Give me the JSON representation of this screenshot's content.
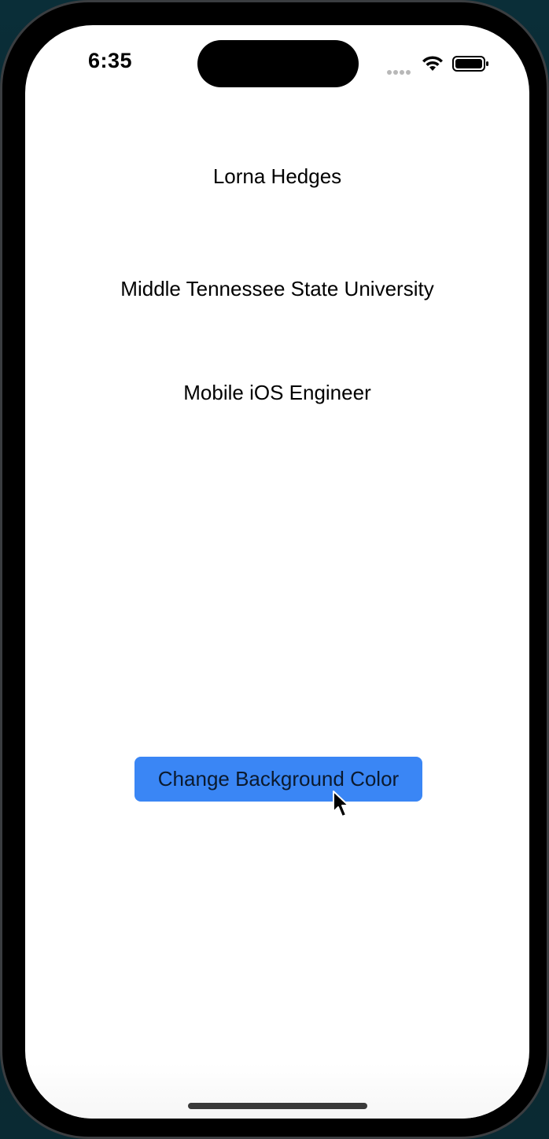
{
  "status_bar": {
    "time": "6:35",
    "icons": [
      "signal-dots-icon",
      "wifi-icon",
      "battery-icon"
    ]
  },
  "content": {
    "name": "Lorna Hedges",
    "university": "Middle Tennessee State University",
    "role": "Mobile iOS Engineer"
  },
  "actions": {
    "change_background_label": "Change Background Color"
  },
  "colors": {
    "button_background": "#3a86f5",
    "screen_background": "#ffffff",
    "text": "#000000"
  }
}
